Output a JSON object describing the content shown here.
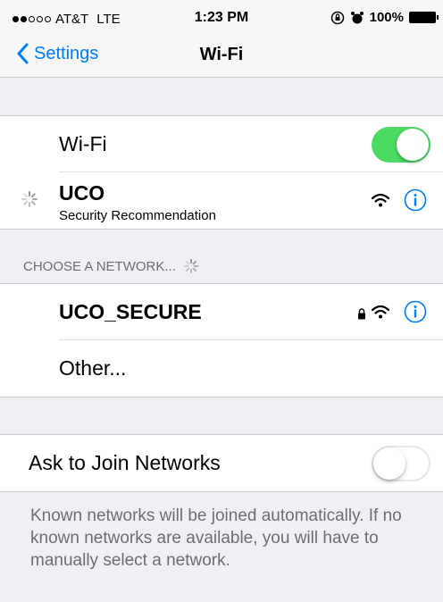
{
  "status_bar": {
    "carrier": "AT&T",
    "network": "LTE",
    "time": "1:23 PM",
    "battery": "100%"
  },
  "nav": {
    "back_label": "Settings",
    "title": "Wi-Fi"
  },
  "wifi_group": {
    "wifi_label": "Wi-Fi",
    "wifi_enabled": true,
    "connected_network": "UCO",
    "connected_subtitle": "Security Recommendation"
  },
  "choose_network": {
    "header": "CHOOSE A NETWORK...",
    "networks": [
      {
        "name": "UCO_SECURE",
        "secured": true
      }
    ],
    "other_label": "Other..."
  },
  "ask_to_join": {
    "label": "Ask to Join Networks",
    "enabled": false,
    "description": "Known networks will be joined automatically. If no known networks are available, you will have to manually select a network."
  },
  "colors": {
    "accent": "#007aff",
    "toggle_on": "#4cd964",
    "background": "#efeff4"
  }
}
